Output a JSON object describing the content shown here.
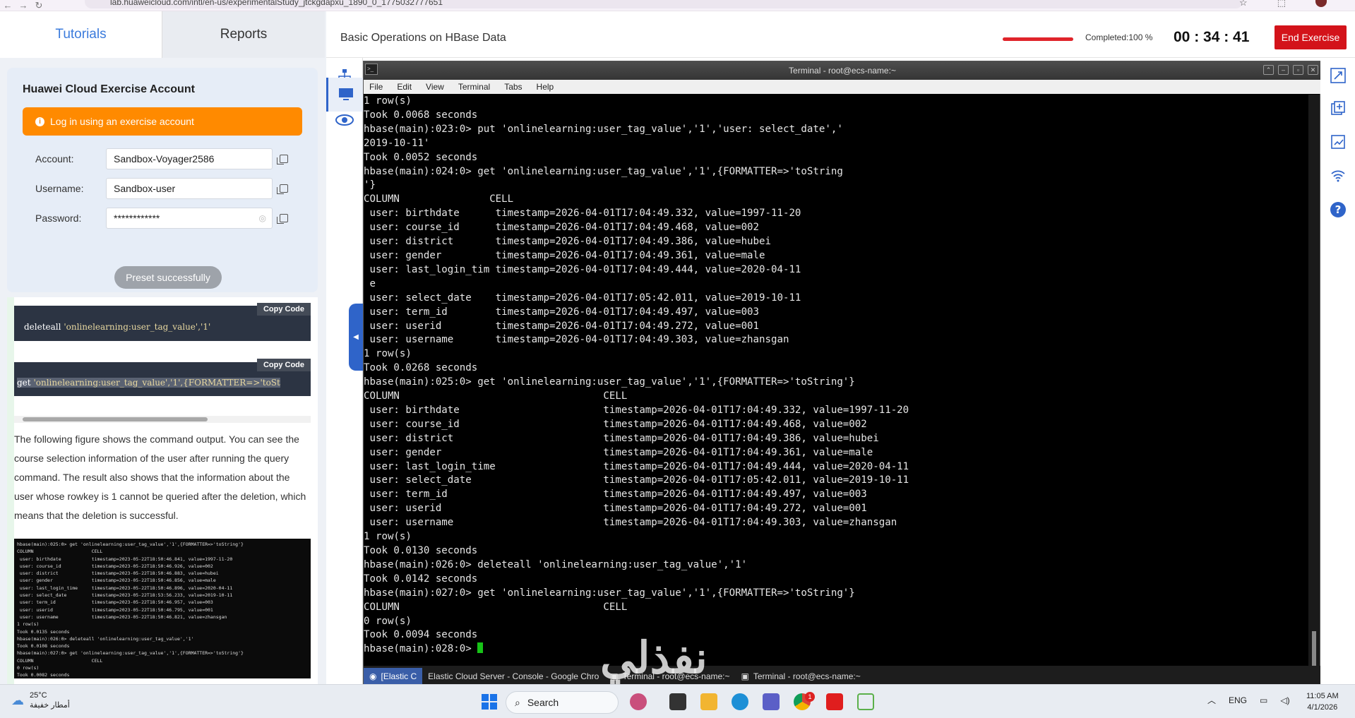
{
  "browser": {
    "url": "lab.huaweicloud.com/intl/en-us/experimentalStudy_jtckgdapxu_1890_0_1775032777651"
  },
  "left_panel": {
    "tabs": [
      "Tutorials",
      "Reports"
    ],
    "account_card": {
      "title": "Huawei Cloud Exercise Account",
      "login_button": "Log in using an exercise account",
      "fields": [
        {
          "label": "Account:",
          "value": "Sandbox-Voyager2586"
        },
        {
          "label": "Username:",
          "value": "Sandbox-user"
        },
        {
          "label": "Password:",
          "value": "************"
        }
      ],
      "preset_button": "Preset successfully"
    },
    "code_blocks": [
      {
        "copy_label": "Copy Code",
        "cmd": "deleteall",
        "arg": "'onlinelearning:user_tag_value','1'"
      },
      {
        "copy_label": "Copy Code",
        "cmd": "get",
        "arg": "'onlinelearning:user_tag_value','1',{FORMATTER=>'toSt"
      }
    ],
    "description": "The following figure shows the command output. You can see the course selection information of the user after running the query command. The result also shows that the information about the user whose rowkey is 1 cannot be queried after the deletion, which means that the deletion is successful.",
    "figure_lines": [
      "hbase(main):025:0> get 'onlinelearning:user_tag_value','1',{FORMATTER=>'toString'}",
      "COLUMN                     CELL",
      " user: birthdate           timestamp=2023-05-22T18:50:46.841, value=1997-11-20",
      " user: course_id           timestamp=2023-05-22T18:50:46.926, value=002",
      " user: district            timestamp=2023-05-22T18:50:46.883, value=hubei",
      " user: gender              timestamp=2023-05-22T18:50:46.856, value=male",
      " user: last_login_time     timestamp=2023-05-22T18:50:46.896, value=2020-04-11",
      " user: select_date         timestamp=2023-05-22T18:53:56.233, value=2019-10-11",
      " user: term_id             timestamp=2023-05-22T18:50:46.957, value=003",
      " user: userid              timestamp=2023-05-22T18:50:46.795, value=001",
      " user: username            timestamp=2023-05-22T18:50:46.821, value=zhansgan",
      "1 row(s)",
      "Took 0.0135 seconds",
      "hbase(main):026:0> deleteall 'onlinelearning:user_tag_value','1'",
      "Took 0.0108 seconds",
      "hbase(main):027:0> get 'onlinelearning:user_tag_value','1',{FORMATTER=>'toString'}",
      "COLUMN                     CELL",
      "0 row(s)",
      "Took 0.0082 seconds"
    ]
  },
  "header": {
    "title": "Basic Operations on HBase Data",
    "completed_label": "Completed:100 %",
    "progress": 1.0,
    "timer": "00 : 34 : 41",
    "end_button": "End Exercise"
  },
  "terminal": {
    "title": "Terminal - root@ecs-name:~",
    "menu": [
      "File",
      "Edit",
      "View",
      "Terminal",
      "Tabs",
      "Help"
    ],
    "lines": [
      "1 row(s)",
      "Took 0.0068 seconds",
      "hbase(main):023:0> put 'onlinelearning:user_tag_value','1','user: select_date','",
      "2019-10-11'",
      "Took 0.0052 seconds",
      "hbase(main):024:0> get 'onlinelearning:user_tag_value','1',{FORMATTER=>'toString",
      "'}",
      "COLUMN               CELL",
      " user: birthdate      timestamp=2026-04-01T17:04:49.332, value=1997-11-20",
      " user: course_id      timestamp=2026-04-01T17:04:49.468, value=002",
      " user: district       timestamp=2026-04-01T17:04:49.386, value=hubei",
      " user: gender         timestamp=2026-04-01T17:04:49.361, value=male",
      " user: last_login_tim timestamp=2026-04-01T17:04:49.444, value=2020-04-11",
      " e",
      " user: select_date    timestamp=2026-04-01T17:05:42.011, value=2019-10-11",
      " user: term_id        timestamp=2026-04-01T17:04:49.497, value=003",
      " user: userid         timestamp=2026-04-01T17:04:49.272, value=001",
      " user: username       timestamp=2026-04-01T17:04:49.303, value=zhansgan",
      "1 row(s)",
      "Took 0.0268 seconds",
      "hbase(main):025:0> get 'onlinelearning:user_tag_value','1',{FORMATTER=>'toString'}",
      "COLUMN                                  CELL",
      " user: birthdate                        timestamp=2026-04-01T17:04:49.332, value=1997-11-20",
      " user: course_id                        timestamp=2026-04-01T17:04:49.468, value=002",
      " user: district                         timestamp=2026-04-01T17:04:49.386, value=hubei",
      " user: gender                           timestamp=2026-04-01T17:04:49.361, value=male",
      " user: last_login_time                  timestamp=2026-04-01T17:04:49.444, value=2020-04-11",
      " user: select_date                      timestamp=2026-04-01T17:05:42.011, value=2019-10-11",
      " user: term_id                          timestamp=2026-04-01T17:04:49.497, value=003",
      " user: userid                           timestamp=2026-04-01T17:04:49.272, value=001",
      " user: username                         timestamp=2026-04-01T17:04:49.303, value=zhansgan",
      "1 row(s)",
      "Took 0.0130 seconds",
      "hbase(main):026:0> deleteall 'onlinelearning:user_tag_value','1'",
      "Took 0.0142 seconds",
      "hbase(main):027:0> get 'onlinelearning:user_tag_value','1',{FORMATTER=>'toString'}",
      "COLUMN                                  CELL",
      "0 row(s)",
      "Took 0.0094 seconds"
    ],
    "prompt": "hbase(main):028:0> "
  },
  "remote_taskbar": {
    "items": [
      "[Elastic C",
      "Elastic Cloud Server - Console - Google Chro",
      "Terminal - root@ecs-name:~",
      "Terminal - root@ecs-name:~"
    ]
  },
  "windows_taskbar": {
    "weather_temp": "25°C",
    "weather_desc": "أمطار خفيفة",
    "search_label": "Search",
    "lang": "ENG",
    "time": "11:05 AM",
    "date": "4/1/2026",
    "notification_count": "1"
  },
  "watermark": "نفذلي",
  "colors": {
    "accent": "#3b7bdc",
    "login_orange": "#ff8a00",
    "end_red": "#d3131a",
    "progress_red": "#e0242a",
    "cursor_green": "#17c317"
  }
}
